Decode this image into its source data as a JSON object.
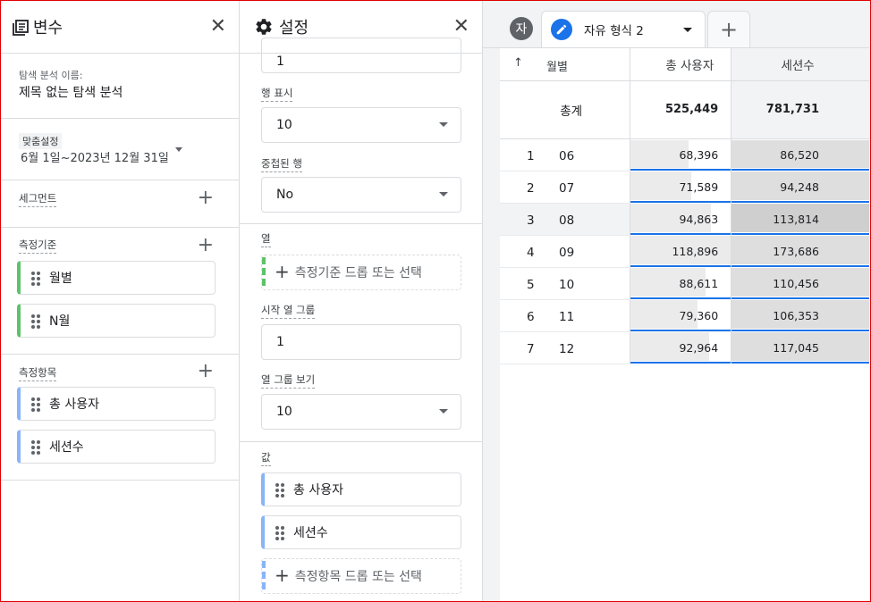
{
  "variables": {
    "title": "변수",
    "exploration_name_label": "탐색 분석 이름:",
    "exploration_name": "제목 없는 탐색 분석",
    "date_badge": "맞춤설정",
    "date_range": "6월 1일~2023년 12월 31일",
    "segments_label": "세그먼트",
    "dimensions_label": "측정기준",
    "dimensions": [
      "월별",
      "N월"
    ],
    "metrics_label": "측정항목",
    "metrics": [
      "총 사용자",
      "세션수"
    ]
  },
  "settings": {
    "title": "설정",
    "top_field_value": "1",
    "show_rows_label": "행 표시",
    "show_rows_value": "10",
    "nested_rows_label": "중첩된 행",
    "nested_rows_value": "No",
    "columns_label": "열",
    "columns_drop": "측정기준 드롭 또는 선택",
    "start_col_group_label": "시작 열 그룹",
    "start_col_group_value": "1",
    "show_col_groups_label": "열 그룹 보기",
    "show_col_groups_value": "10",
    "values_label": "값",
    "values": [
      "총 사용자",
      "세션수"
    ],
    "values_drop": "측정항목 드롭 또는 선택"
  },
  "tabs": {
    "avatar_letter": "자",
    "active_tab": "자유 형식 2"
  },
  "table": {
    "headers": [
      "월별",
      "총 사용자",
      "세션수"
    ],
    "totals_label": "총계",
    "totals": [
      "525,449",
      "781,731"
    ],
    "rows": [
      {
        "idx": "1",
        "month": "06",
        "users": "68,396",
        "sessions": "86,520"
      },
      {
        "idx": "2",
        "month": "07",
        "users": "71,589",
        "sessions": "94,248"
      },
      {
        "idx": "3",
        "month": "08",
        "users": "94,863",
        "sessions": "113,814"
      },
      {
        "idx": "4",
        "month": "09",
        "users": "118,896",
        "sessions": "173,686"
      },
      {
        "idx": "5",
        "month": "10",
        "users": "88,611",
        "sessions": "110,456"
      },
      {
        "idx": "6",
        "month": "11",
        "users": "79,360",
        "sessions": "106,353"
      },
      {
        "idx": "7",
        "month": "12",
        "users": "92,964",
        "sessions": "117,045"
      }
    ],
    "users_fraction": [
      0.575,
      0.602,
      0.798,
      1.0,
      0.745,
      0.667,
      0.782
    ],
    "sessions_fraction": [
      0.498,
      0.543,
      0.655,
      1.0,
      0.636,
      0.612,
      0.674
    ]
  },
  "colors": {
    "accent_blue": "#1a73e8",
    "dimension_chip": "#5ec269",
    "metric_chip": "#8ab4f8",
    "frame": "#e00000"
  }
}
